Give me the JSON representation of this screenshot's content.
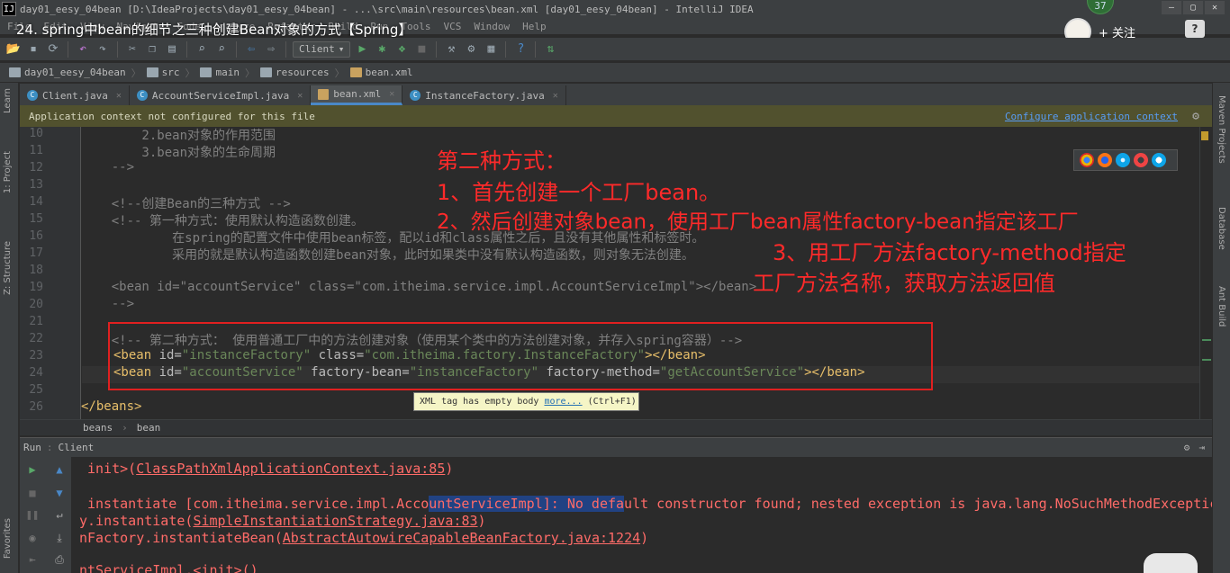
{
  "window": {
    "title": "day01_eesy_04bean [D:\\IdeaProjects\\day01_eesy_04bean] - ...\\src\\main\\resources\\bean.xml [day01_eesy_04bean] - IntelliJ IDEA",
    "logo": "IJ",
    "controls": [
      "—",
      "▢",
      "✕"
    ]
  },
  "menu": [
    "File",
    "Edit",
    "View",
    "Navigate",
    "Code",
    "Analyze",
    "Refactor",
    "Build",
    "Run",
    "Tools",
    "VCS",
    "Window",
    "Help"
  ],
  "video_overlay": {
    "title": "24. spring中bean的细节之三种创建Bean对象的方式【Spring】",
    "badge_count": "37",
    "follow_label": "+ 关注",
    "help": "?"
  },
  "toolbar": {
    "run_config": "Client",
    "icons": [
      "open-icon",
      "save-icon",
      "sync-icon",
      "undo-icon",
      "redo-icon",
      "cut-icon",
      "copy-icon",
      "paste-icon",
      "find-icon",
      "replace-icon",
      "back-icon",
      "forward-icon",
      "run-icon",
      "debug-icon",
      "coverage-icon",
      "stop-icon",
      "project-structure-icon",
      "settings-icon",
      "sdk-icon",
      "help-icon",
      "update-icon"
    ]
  },
  "breadcrumb": [
    "day01_eesy_04bean",
    "src",
    "main",
    "resources",
    "bean.xml"
  ],
  "tabs": [
    {
      "label": "Client.java",
      "kind": "class"
    },
    {
      "label": "AccountServiceImpl.java",
      "kind": "class"
    },
    {
      "label": "bean.xml",
      "kind": "xml",
      "active": true
    },
    {
      "label": "InstanceFactory.java",
      "kind": "class"
    }
  ],
  "notification": {
    "text": "Application context not configured for this file",
    "link": "Configure application context"
  },
  "left_tools": [
    "1: Project",
    "Learn",
    "Z: Structure",
    "Favorites"
  ],
  "right_tools": [
    "Maven Projects",
    "Database",
    "Ant Build"
  ],
  "editor": {
    "line_numbers": [
      "10",
      "11",
      "12",
      "13",
      "14",
      "15",
      "16",
      "17",
      "18",
      "19",
      "20",
      "21",
      "22",
      "23",
      "24",
      "25",
      "26"
    ],
    "lines": {
      "l10": "        2.bean对象的作用范围",
      "l11": "        3.bean对象的生命周期",
      "l12": "    -->",
      "l14": "    <!--创建Bean的三种方式 -->",
      "l15": "    <!-- 第一种方式：使用默认构造函数创建。",
      "l16": "            在spring的配置文件中使用bean标签，配以id和class属性之后，且没有其他属性和标签时。",
      "l17": "            采用的就是默认构造函数创建bean对象，此时如果类中没有默认构造函数，则对象无法创建。",
      "l19": "    <bean id=\"accountService\" class=\"com.itheima.service.impl.AccountServiceImpl\"></bean>",
      "l20": "    -->",
      "l22": "    <!-- 第二种方式： 使用普通工厂中的方法创建对象（使用某个类中的方法创建对象，并存入spring容器）-->",
      "l26": "</beans>"
    },
    "l23": {
      "open": "<bean ",
      "id_attr": "id=",
      "id_val": "\"instanceFactory\"",
      "class_attr": " class=",
      "class_val": "\"com.itheima.factory.InstanceFactory\"",
      "close": "></bean>"
    },
    "l24": {
      "open": "<bean ",
      "id_attr": "id=",
      "id_val": "\"accountService\"",
      "fb_attr": " factory-bean=",
      "fb_val": "\"instanceFactory\"",
      "fm_attr": " factory-method=",
      "fm_val": "\"getAccountService\"",
      "close": "></bean>"
    },
    "tooltip": {
      "text": "XML tag has empty body",
      "more": "more...",
      "shortcut": "(Ctrl+F1)"
    },
    "path": [
      "beans",
      "bean"
    ]
  },
  "annotation": {
    "heading": "第二种方式：",
    "step1": "1、首先创建一个工厂bean。",
    "step2": "2、然后创建对象bean，使用工厂bean属性factory-bean指定该工厂",
    "step3": "3、用工厂方法factory-method指定",
    "step3b": "工厂方法名称，获取方法返回值",
    "color": "#ff2a2a"
  },
  "run_panel": {
    "label": "Run",
    "config": "Client",
    "console": {
      "c1_pre": "init>(",
      "c1_link": "ClassPathXmlApplicationContext.java:85",
      "c1_post": ")",
      "c2_pre": "instantiate [com.itheima.service.impl.Acco",
      "c2_sel1": "untServiceImpl]: No defa",
      "c2_post": "ult constructor found; nested exception is java.lang.NoSuchMethodExceptic",
      "c3_pre": "y.instantiate(",
      "c3_link": "SimpleInstantiationStrategy.java:83",
      "c3_post": ")",
      "c4_pre": "nFactory.instantiateBean(",
      "c4_link": "AbstractAutowireCapableBeanFactory.java:1224",
      "c4_post": ")",
      "c5": "ntServiceImpl.<init>()"
    }
  }
}
